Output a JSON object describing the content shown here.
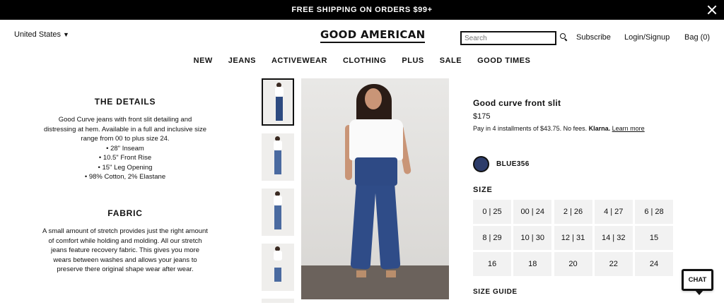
{
  "promo": {
    "text": "FREE SHIPPING ON ORDERS $99+"
  },
  "header": {
    "country": "United States",
    "logo": "GOOD AMERICAN",
    "search_placeholder": "Search",
    "subscribe": "Subscribe",
    "login": "Login/Signup",
    "bag": "Bag (0)"
  },
  "nav": [
    "NEW",
    "JEANS",
    "ACTIVEWEAR",
    "CLOTHING",
    "PLUS",
    "SALE",
    "GOOD TIMES"
  ],
  "details": {
    "title": "THE DETAILS",
    "description": "Good Curve jeans with front slit detailing and distressing at hem. Available in a full and inclusive size range from 00 to plus size 24.",
    "bullets": [
      "28\" Inseam",
      "10.5\" Front Rise",
      "15\" Leg Opening",
      "98% Cotton, 2% Elastane"
    ]
  },
  "fabric": {
    "title": "FABRIC",
    "text": "A small amount of stretch provides just the right amount of comfort while holding and molding. All our stretch jeans feature recovery fabric. This gives you more wears between washes and allows your jeans to preserve there original shape wear after wear."
  },
  "product": {
    "title": "Good curve front slit",
    "price": "$175",
    "klarna_text": "Pay in 4 installments of $43.75. No fees.",
    "klarna_brand": "Klarna.",
    "learn_more": "Learn more",
    "color_name": "BLUE356",
    "color_hex": "#2d3c6a",
    "size_heading": "SIZE",
    "sizes": [
      "0 | 25",
      "00 | 24",
      "2 | 26",
      "4 | 27",
      "6 | 28",
      "8 | 29",
      "10 | 30",
      "12 | 31",
      "14 | 32",
      "15",
      "16",
      "18",
      "20",
      "22",
      "24"
    ],
    "size_guide": "SIZE GUIDE"
  },
  "chat": {
    "label": "CHAT"
  }
}
